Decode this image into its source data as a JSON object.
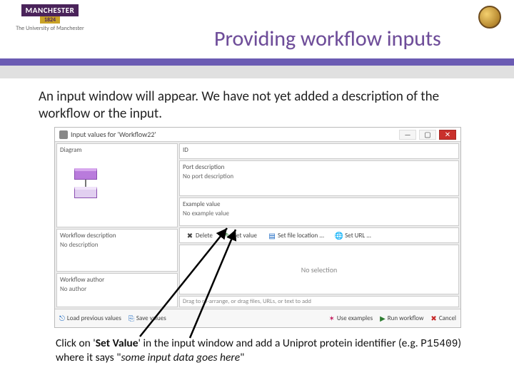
{
  "header": {
    "logo_main": "MANCHESTER",
    "logo_year": "1824",
    "logo_sub": "The University of Manchester"
  },
  "slide": {
    "title": "Providing workflow inputs",
    "intro": "An input window will appear. We have not yet added a description of the workflow or the input.",
    "outro_pre": "Click on '",
    "outro_bold": "Set Value",
    "outro_mid": "' in the input window and add a Uniprot protein identifier (e.g. ",
    "outro_mono": "P15409",
    "outro_post": ") where it says \"",
    "outro_italic": "some input data goes here",
    "outro_end": "\""
  },
  "dialog": {
    "title": "Input values for 'Workflow22'",
    "left": {
      "diagram_title": "Diagram",
      "wfdesc_title": "Workflow description",
      "wfdesc_body": "No description",
      "wfauth_title": "Workflow author",
      "wfauth_body": "No author"
    },
    "right": {
      "id_title": "ID",
      "portdesc_title": "Port description",
      "portdesc_body": "No port description",
      "example_title": "Example value",
      "example_body": "No example value",
      "toolbar": {
        "delete": "Delete",
        "set_value": "Set value",
        "set_file": "Set file location ...",
        "set_url": "Set URL ..."
      },
      "valpanel": "No selection",
      "draghint": "Drag to re-arrange, or drag files, URLs, or text to add"
    },
    "bottom": {
      "load": "Load previous values",
      "save": "Save values",
      "examples": "Use examples",
      "run": "Run workflow",
      "cancel": "Cancel"
    }
  }
}
